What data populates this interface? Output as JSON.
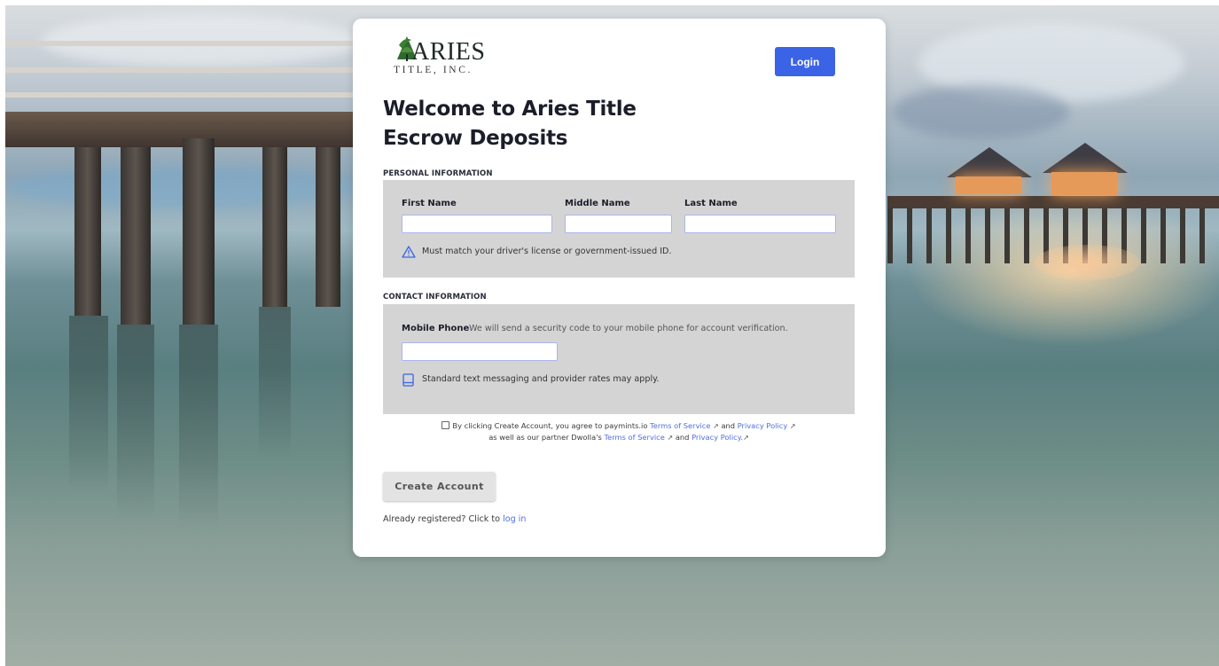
{
  "header": {
    "logo_text": "ARIES",
    "logo_subtext": "TITLE, INC.",
    "login_label": "Login"
  },
  "page": {
    "title": "Welcome to Aries Title Escrow Deposits"
  },
  "personal": {
    "section_label": "PERSONAL INFORMATION",
    "first_name_label": "First Name",
    "middle_name_label": "Middle Name",
    "last_name_label": "Last Name",
    "first_name_value": "",
    "middle_name_value": "",
    "last_name_value": "",
    "id_note": "Must match your driver's license or government-issued ID."
  },
  "contact": {
    "section_label": "CONTACT INFORMATION",
    "mobile_label": "Mobile Phone",
    "mobile_hint": "We will send a security code to your mobile phone for account verification.",
    "mobile_value": "",
    "sms_note": "Standard text messaging and provider rates may apply."
  },
  "agreement": {
    "text_1": "By clicking Create Account, you agree to paymints.io",
    "tos_1": "Terms of Service",
    "and_1": "and",
    "privacy_1": "Privacy Policy",
    "text_2": "as well as our partner Dwolla's",
    "tos_2": "Terms of Service",
    "and_2": "and",
    "privacy_2": "Privacy Policy.",
    "checked": false
  },
  "actions": {
    "create_label": "Create Account",
    "already_text": "Already registered? Click to",
    "login_link": "log in"
  },
  "icons": {
    "warning": "warning-triangle-icon",
    "phone": "mobile-phone-icon",
    "external": "external-link-icon"
  },
  "colors": {
    "accent": "#3b63e6",
    "link": "#4d6fe0",
    "panel": "#d4d4d4"
  }
}
